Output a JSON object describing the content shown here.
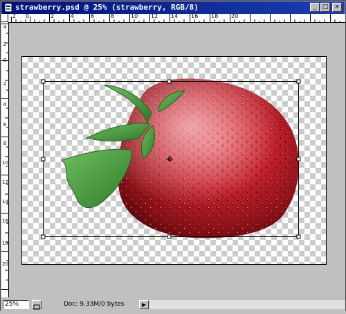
{
  "window": {
    "title": "strawberry.psd @ 25% (strawberry, RGB/8)",
    "buttons": {
      "minimize": "_",
      "maximize": "□",
      "close": "×"
    }
  },
  "ruler_top": {
    "labels": [
      "2",
      "0",
      "2",
      "4",
      "6",
      "8",
      "10",
      "12",
      "14",
      "16",
      "18",
      "20"
    ]
  },
  "ruler_left": {
    "labels": [
      "4",
      "2",
      "0",
      "2",
      "4",
      "6",
      "8",
      "10",
      "12",
      "14",
      "16",
      "18",
      "20"
    ]
  },
  "status": {
    "zoom": "25%",
    "doc_info": "Doc: 9.33M/0 bytes",
    "arrow_glyph": "▶"
  },
  "colors": {
    "title_bar": "#00107a",
    "checker": "#cccccc",
    "strawberry": "#c8202c",
    "leaves": "#3f9a34"
  },
  "icons": [
    "document-icon",
    "minimize-icon",
    "maximize-icon",
    "close-icon",
    "nav-icon",
    "status-arrow-icon",
    "move-crosshair-icon"
  ]
}
